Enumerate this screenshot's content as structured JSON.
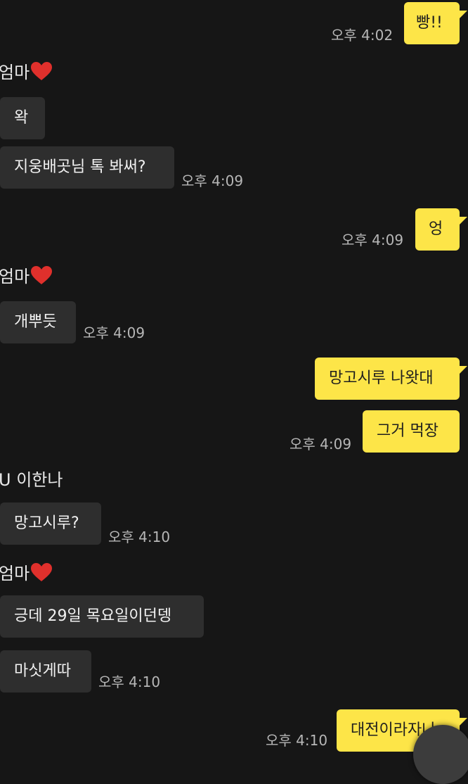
{
  "messages": [
    {
      "text": "빵!!",
      "time": "오후 4:02"
    },
    {
      "sender": "엄마",
      "text": "왁"
    },
    {
      "text": "지웅배곳님 톡 봐써?",
      "time": "오후 4:09"
    },
    {
      "text": "엉",
      "time": "오후 4:09"
    },
    {
      "sender": "엄마",
      "text": "개뿌듯",
      "time": "오후 4:09"
    },
    {
      "text": "망고시루 나왓대"
    },
    {
      "text": "그거 먹장",
      "time": "오후 4:09"
    },
    {
      "sender": "U 이한나",
      "text": "망고시루?",
      "time": "오후 4:10"
    },
    {
      "sender": "엄마",
      "text": "긍데 29일 목요일이던뎅"
    },
    {
      "text": "마싯게따",
      "time": "오후 4:10"
    },
    {
      "text": "대전이라자나",
      "time": "오후 4:10"
    }
  ],
  "colors": {
    "background": "#161616",
    "incoming_bubble": "#2e2e2e",
    "outgoing_bubble": "#fde548",
    "heart": "#e0302c"
  },
  "icons": {
    "heart": "red-heart-icon"
  }
}
